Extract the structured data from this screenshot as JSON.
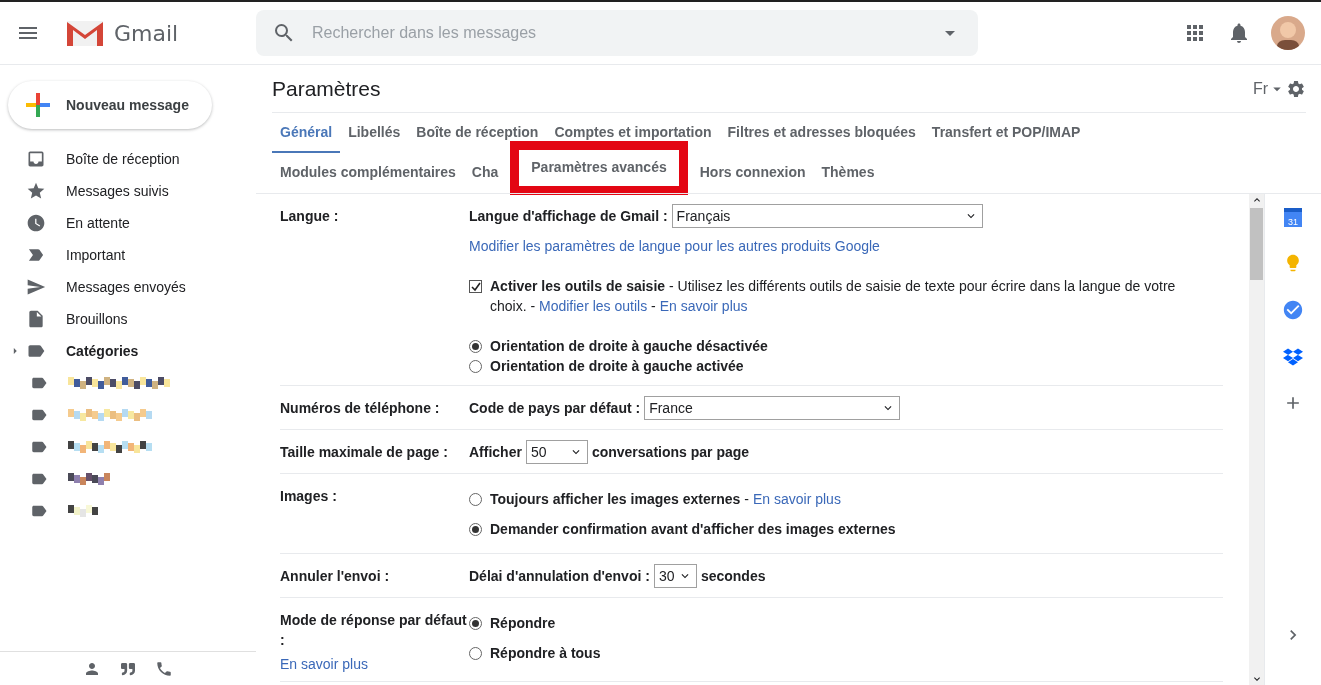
{
  "header": {
    "app_name": "Gmail",
    "search": {
      "placeholder": "Rechercher dans les messages"
    }
  },
  "compose": {
    "label": "Nouveau message"
  },
  "sidebar": {
    "items": [
      {
        "kind": "inbox",
        "label": "Boîte de réception",
        "bold": false
      },
      {
        "kind": "star",
        "label": "Messages suivis",
        "bold": false
      },
      {
        "kind": "clock",
        "label": "En attente",
        "bold": false
      },
      {
        "kind": "important",
        "label": "Important",
        "bold": false
      },
      {
        "kind": "send",
        "label": "Messages envoyés",
        "bold": false
      },
      {
        "kind": "draft",
        "label": "Brouillons",
        "bold": false
      },
      {
        "kind": "category",
        "label": "Catégories",
        "bold": true
      }
    ]
  },
  "page": {
    "title": "Paramètres",
    "language": "Fr"
  },
  "tabs": [
    [
      {
        "label": "Général",
        "selected": true
      },
      {
        "label": "Libellés",
        "selected": false
      },
      {
        "label": "Boîte de réception",
        "selected": false
      },
      {
        "label": "Comptes et importation",
        "selected": false
      },
      {
        "label": "Filtres et adresses bloquées",
        "selected": false
      },
      {
        "label": "Transfert et POP/IMAP",
        "selected": false
      }
    ],
    [
      {
        "label": "Modules complémentaires",
        "selected": false
      },
      {
        "label": "Cha",
        "selected": false
      },
      {
        "label": "Paramètres avancés",
        "selected": false,
        "highlighted": true
      },
      {
        "label": "Hors connexion",
        "selected": false
      },
      {
        "label": "Thèmes",
        "selected": false
      }
    ]
  ],
  "settings": [
    {
      "label": "Langue :",
      "controls": [
        {
          "kind": "select",
          "label": "Langue d'affichage de Gmail :",
          "value": "Français"
        },
        {
          "kind": "link",
          "text": "Modifier les paramètres de langue pour les autres produits Google"
        },
        {
          "kind": "checkbox",
          "checked": true,
          "text": "**Activer les outils de saisie** - Utilisez les différents outils de saisie de texte pour écrire dans la langue de votre choix. - ",
          "links": [
            "Modifier les outils",
            "En savoir plus"
          ],
          "separator": " - "
        },
        {
          "kind": "radio",
          "selected": true,
          "text": "Orientation de droite à gauche désactivée"
        },
        {
          "kind": "radio",
          "selected": false,
          "text": "Orientation de droite à gauche activée"
        }
      ]
    },
    {
      "label": "Numéros de téléphone :",
      "controls": [
        {
          "kind": "select",
          "label": "Code de pays par défaut :",
          "value": "France"
        }
      ]
    },
    {
      "label": "Taille maximale de page :",
      "controls": [
        {
          "kind": "select",
          "label": "Afficher",
          "value": "50",
          "after": "conversations par page"
        }
      ]
    },
    {
      "label": "Images :",
      "controls": [
        {
          "kind": "radio",
          "selected": false,
          "text": "Toujours afficher les images externes",
          "separator": "-",
          "link": "En savoir plus"
        },
        {
          "kind": "radio",
          "selected": true,
          "text": "Demander confirmation avant d'afficher des images externes"
        }
      ]
    },
    {
      "label": "Annuler l'envoi :",
      "controls": [
        {
          "kind": "select",
          "label": "Délai d'annulation d'envoi :",
          "value": "30",
          "after": "secondes"
        }
      ]
    },
    {
      "label": "Mode de réponse par défaut :",
      "link": "En savoir plus",
      "controls": [
        {
          "kind": "radio",
          "selected": true,
          "text": "Répondre"
        },
        {
          "kind": "radio",
          "selected": false,
          "text": "Répondre à tous"
        }
      ]
    }
  ],
  "addons": [
    {
      "kind": "calendar",
      "label": "31"
    },
    {
      "kind": "keep"
    },
    {
      "kind": "tasks"
    },
    {
      "kind": "dropbox"
    },
    {
      "kind": "add"
    }
  ]
}
